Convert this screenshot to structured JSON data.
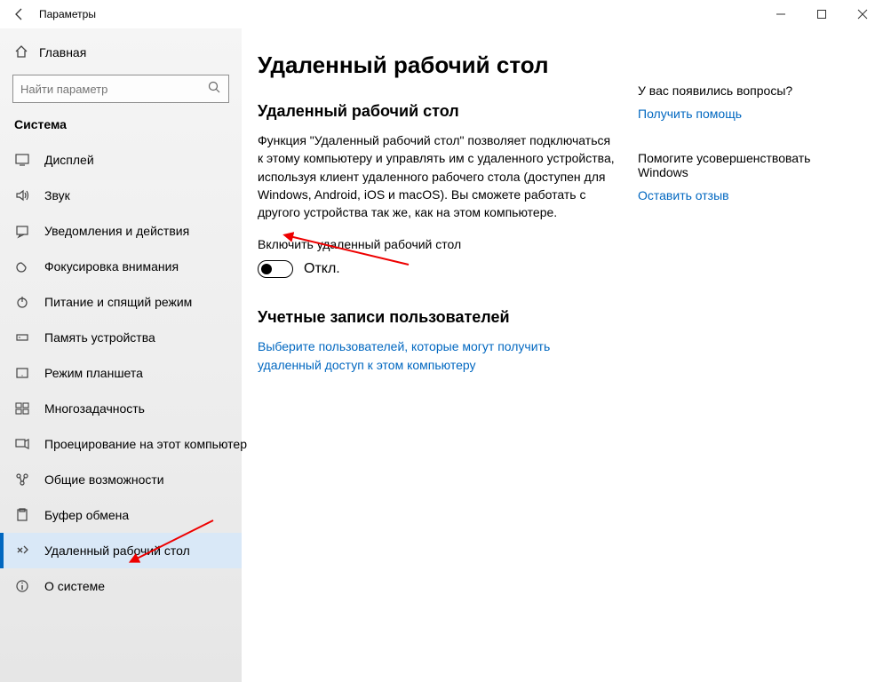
{
  "titlebar": {
    "title": "Параметры"
  },
  "sidebar": {
    "home": "Главная",
    "search_placeholder": "Найти параметр",
    "section": "Система",
    "items": [
      {
        "label": "Дисплей"
      },
      {
        "label": "Звук"
      },
      {
        "label": "Уведомления и действия"
      },
      {
        "label": "Фокусировка внимания"
      },
      {
        "label": "Питание и спящий режим"
      },
      {
        "label": "Память устройства"
      },
      {
        "label": "Режим планшета"
      },
      {
        "label": "Многозадачность"
      },
      {
        "label": "Проецирование на этот компьютер"
      },
      {
        "label": "Общие возможности"
      },
      {
        "label": "Буфер обмена"
      },
      {
        "label": "Удаленный рабочий стол"
      },
      {
        "label": "О системе"
      }
    ]
  },
  "content": {
    "page_title": "Удаленный рабочий стол",
    "section1_title": "Удаленный рабочий стол",
    "section1_desc": "Функция \"Удаленный рабочий стол\" позволяет подключаться к этому компьютеру и управлять им с удаленного устройства, используя клиент удаленного рабочего стола (доступен для Windows, Android, iOS и macOS). Вы сможете работать с другого устройства так же, как на этом компьютере.",
    "toggle_label": "Включить удаленный рабочий стол",
    "toggle_state": "Откл.",
    "section2_title": "Учетные записи пользователей",
    "users_link": "Выберите пользователей, которые могут получить удаленный доступ к этом компьютеру"
  },
  "aside": {
    "help_q": "У вас появились вопросы?",
    "help_link": "Получить помощь",
    "feedback_q": "Помогите усовершенствовать Windows",
    "feedback_link": "Оставить отзыв"
  }
}
